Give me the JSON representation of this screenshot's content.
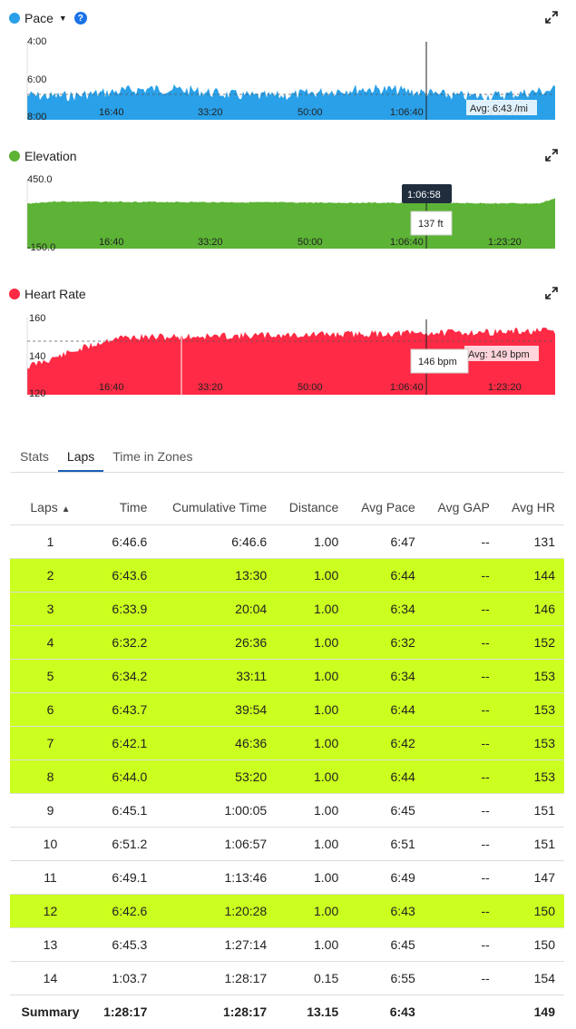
{
  "charts": {
    "pace": {
      "title": "Pace",
      "color": "#29a0e8",
      "y_ticks": [
        "4:00",
        "6:00",
        "8:00"
      ],
      "x_ticks": [
        "16:40",
        "33:20",
        "50:00",
        "1:06:40",
        "1:23:20"
      ],
      "avg_label": "Avg: 6:43 /mi",
      "icons": [
        "caret-down-icon",
        "help-icon",
        "expand-icon"
      ]
    },
    "elevation": {
      "title": "Elevation",
      "color": "#5cb335",
      "y_ticks": [
        "450.0",
        "-150.0"
      ],
      "x_ticks": [
        "16:40",
        "33:20",
        "50:00",
        "1:06:40",
        "1:23:20"
      ],
      "hover_time": "1:06:58",
      "hover_value": "137 ft",
      "icons": [
        "expand-icon"
      ]
    },
    "heart_rate": {
      "title": "Heart Rate",
      "color": "#ff2a45",
      "y_ticks": [
        "160",
        "140",
        "120"
      ],
      "x_ticks": [
        "16:40",
        "33:20",
        "50:00",
        "1:06:40",
        "1:23:20"
      ],
      "hover_value": "146 bpm",
      "avg_label": "Avg: 149 bpm",
      "icons": [
        "expand-icon"
      ]
    }
  },
  "tabs": [
    {
      "label": "Stats",
      "active": false
    },
    {
      "label": "Laps",
      "active": true
    },
    {
      "label": "Time in Zones",
      "active": false
    }
  ],
  "table": {
    "headers": [
      "Laps",
      "Time",
      "Cumulative Time",
      "Distance",
      "Avg Pace",
      "Avg GAP",
      "Avg HR"
    ],
    "sort_indicator": "▲",
    "highlight_color": "#cbff1f",
    "rows": [
      {
        "lap": "1",
        "time": "6:46.6",
        "cum": "6:46.6",
        "dist": "1.00",
        "pace": "6:47",
        "gap": "--",
        "hr": "131",
        "highlight": false
      },
      {
        "lap": "2",
        "time": "6:43.6",
        "cum": "13:30",
        "dist": "1.00",
        "pace": "6:44",
        "gap": "--",
        "hr": "144",
        "highlight": true
      },
      {
        "lap": "3",
        "time": "6:33.9",
        "cum": "20:04",
        "dist": "1.00",
        "pace": "6:34",
        "gap": "--",
        "hr": "146",
        "highlight": true
      },
      {
        "lap": "4",
        "time": "6:32.2",
        "cum": "26:36",
        "dist": "1.00",
        "pace": "6:32",
        "gap": "--",
        "hr": "152",
        "highlight": true
      },
      {
        "lap": "5",
        "time": "6:34.2",
        "cum": "33:11",
        "dist": "1.00",
        "pace": "6:34",
        "gap": "--",
        "hr": "153",
        "highlight": true
      },
      {
        "lap": "6",
        "time": "6:43.7",
        "cum": "39:54",
        "dist": "1.00",
        "pace": "6:44",
        "gap": "--",
        "hr": "153",
        "highlight": true
      },
      {
        "lap": "7",
        "time": "6:42.1",
        "cum": "46:36",
        "dist": "1.00",
        "pace": "6:42",
        "gap": "--",
        "hr": "153",
        "highlight": true
      },
      {
        "lap": "8",
        "time": "6:44.0",
        "cum": "53:20",
        "dist": "1.00",
        "pace": "6:44",
        "gap": "--",
        "hr": "153",
        "highlight": true
      },
      {
        "lap": "9",
        "time": "6:45.1",
        "cum": "1:00:05",
        "dist": "1.00",
        "pace": "6:45",
        "gap": "--",
        "hr": "151",
        "highlight": false
      },
      {
        "lap": "10",
        "time": "6:51.2",
        "cum": "1:06:57",
        "dist": "1.00",
        "pace": "6:51",
        "gap": "--",
        "hr": "151",
        "highlight": false
      },
      {
        "lap": "11",
        "time": "6:49.1",
        "cum": "1:13:46",
        "dist": "1.00",
        "pace": "6:49",
        "gap": "--",
        "hr": "147",
        "highlight": false
      },
      {
        "lap": "12",
        "time": "6:42.6",
        "cum": "1:20:28",
        "dist": "1.00",
        "pace": "6:43",
        "gap": "--",
        "hr": "150",
        "highlight": true
      },
      {
        "lap": "13",
        "time": "6:45.3",
        "cum": "1:27:14",
        "dist": "1.00",
        "pace": "6:45",
        "gap": "--",
        "hr": "150",
        "highlight": false
      },
      {
        "lap": "14",
        "time": "1:03.7",
        "cum": "1:28:17",
        "dist": "0.15",
        "pace": "6:55",
        "gap": "--",
        "hr": "154",
        "highlight": false
      }
    ],
    "summary": {
      "lap": "Summary",
      "time": "1:28:17",
      "cum": "1:28:17",
      "dist": "13.15",
      "pace": "6:43",
      "gap": "",
      "hr": "149"
    }
  }
}
